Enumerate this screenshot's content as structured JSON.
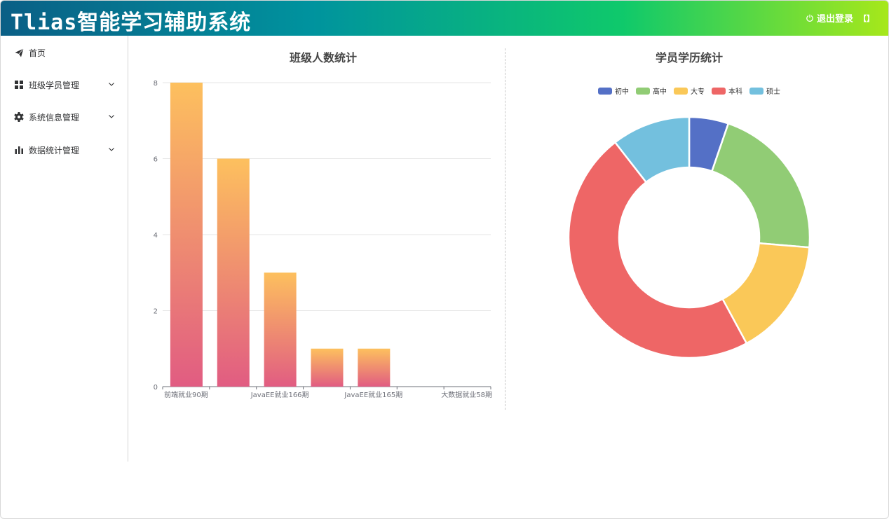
{
  "header": {
    "app_title": "Tlias智能学习辅助系统",
    "logout_label": "退出登录",
    "extra_icon": "【】"
  },
  "sidebar": {
    "items": [
      {
        "label": "首页",
        "icon": "paper-plane-icon",
        "expandable": false
      },
      {
        "label": "班级学员管理",
        "icon": "grid-icon",
        "expandable": true
      },
      {
        "label": "系统信息管理",
        "icon": "gear-icon",
        "expandable": true
      },
      {
        "label": "数据统计管理",
        "icon": "bar-chart-icon",
        "expandable": true
      }
    ]
  },
  "chart_data": [
    {
      "type": "bar",
      "title": "班级人数统计",
      "categories": [
        "前端就业90期",
        "JavaEE就业166期",
        "JavaEE就业165期",
        "大数据就业58期"
      ],
      "tick_labels_shown": [
        "前端就业90期",
        "JavaEE就业166期",
        "JavaEE就业165期",
        "大数据就业58期"
      ],
      "values": [
        8,
        6,
        3,
        1,
        1,
        0,
        0
      ],
      "bar_count": 7,
      "ylim": [
        0,
        8
      ],
      "yticks": [
        0,
        2,
        4,
        6,
        8
      ],
      "grid": true,
      "bar_gradient": [
        "#fdc05e",
        "#e15c82"
      ]
    },
    {
      "type": "pie",
      "title": "学员学历统计",
      "donut": true,
      "legend_position": "top-center",
      "slices": [
        {
          "name": "初中",
          "value": 1,
          "color": "#5470c6"
        },
        {
          "name": "高中",
          "value": 4,
          "color": "#91cc75"
        },
        {
          "name": "大专",
          "value": 3,
          "color": "#fac858"
        },
        {
          "name": "本科",
          "value": 9,
          "color": "#ee6666"
        },
        {
          "name": "硕士",
          "value": 2,
          "color": "#73c0de"
        }
      ]
    }
  ]
}
